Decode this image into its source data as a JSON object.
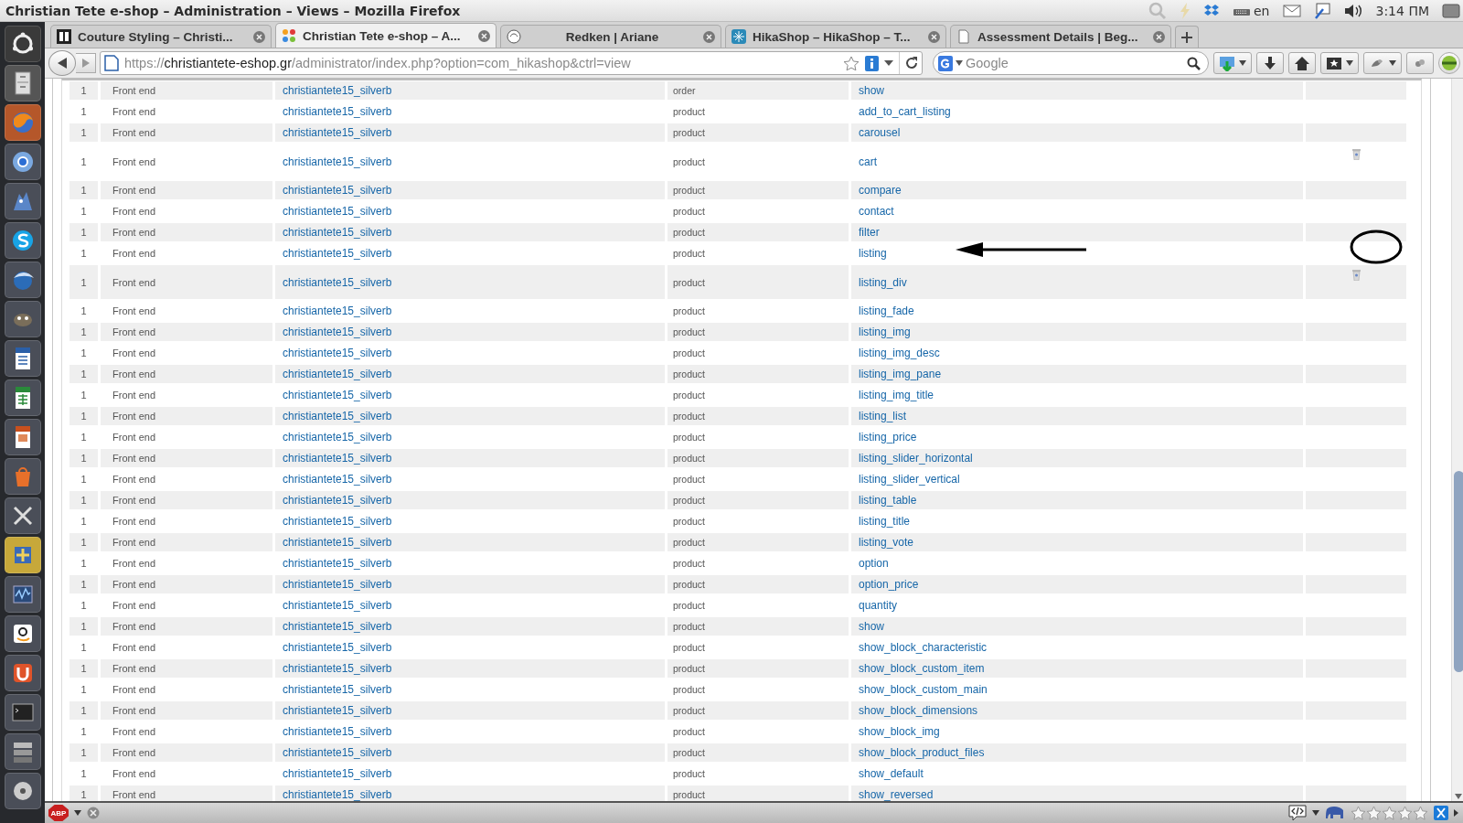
{
  "window": {
    "title": "Christian Tete e-shop – Administration – Views – Mozilla Firefox"
  },
  "system_tray": {
    "language": "en",
    "time": "3:14 ПМ"
  },
  "tabs": [
    {
      "label": "Couture Styling – Christi...",
      "selected": false
    },
    {
      "label": "Christian Tete e-shop – A...",
      "selected": true
    },
    {
      "label": "Redken | Ariane",
      "selected": false
    },
    {
      "label": "HikaShop – HikaShop – T...",
      "selected": false
    },
    {
      "label": "Assessment Details | Beg...",
      "selected": false
    }
  ],
  "address_bar": {
    "scheme": "https://",
    "domain": "christiantete-eshop.gr",
    "path": "/administrator/index.php?option=com_hikashop&ctrl=view"
  },
  "search": {
    "placeholder": "Google"
  },
  "table": {
    "rows": [
      {
        "order": "1",
        "client": "Front end",
        "template": "christiantete15_silverb",
        "type": "order",
        "view": "show",
        "trash": false
      },
      {
        "order": "1",
        "client": "Front end",
        "template": "christiantete15_silverb",
        "type": "product",
        "view": "add_to_cart_listing",
        "trash": false
      },
      {
        "order": "1",
        "client": "Front end",
        "template": "christiantete15_silverb",
        "type": "product",
        "view": "carousel",
        "trash": false
      },
      {
        "order": "1",
        "client": "Front end",
        "template": "christiantete15_silverb",
        "type": "product",
        "view": "cart",
        "trash": true
      },
      {
        "order": "1",
        "client": "Front end",
        "template": "christiantete15_silverb",
        "type": "product",
        "view": "compare",
        "trash": false
      },
      {
        "order": "1",
        "client": "Front end",
        "template": "christiantete15_silverb",
        "type": "product",
        "view": "contact",
        "trash": false
      },
      {
        "order": "1",
        "client": "Front end",
        "template": "christiantete15_silverb",
        "type": "product",
        "view": "filter",
        "trash": false
      },
      {
        "order": "1",
        "client": "Front end",
        "template": "christiantete15_silverb",
        "type": "product",
        "view": "listing",
        "trash": false
      },
      {
        "order": "1",
        "client": "Front end",
        "template": "christiantete15_silverb",
        "type": "product",
        "view": "listing_div",
        "trash": true
      },
      {
        "order": "1",
        "client": "Front end",
        "template": "christiantete15_silverb",
        "type": "product",
        "view": "listing_fade",
        "trash": false
      },
      {
        "order": "1",
        "client": "Front end",
        "template": "christiantete15_silverb",
        "type": "product",
        "view": "listing_img",
        "trash": false
      },
      {
        "order": "1",
        "client": "Front end",
        "template": "christiantete15_silverb",
        "type": "product",
        "view": "listing_img_desc",
        "trash": false
      },
      {
        "order": "1",
        "client": "Front end",
        "template": "christiantete15_silverb",
        "type": "product",
        "view": "listing_img_pane",
        "trash": false
      },
      {
        "order": "1",
        "client": "Front end",
        "template": "christiantete15_silverb",
        "type": "product",
        "view": "listing_img_title",
        "trash": false
      },
      {
        "order": "1",
        "client": "Front end",
        "template": "christiantete15_silverb",
        "type": "product",
        "view": "listing_list",
        "trash": false
      },
      {
        "order": "1",
        "client": "Front end",
        "template": "christiantete15_silverb",
        "type": "product",
        "view": "listing_price",
        "trash": false
      },
      {
        "order": "1",
        "client": "Front end",
        "template": "christiantete15_silverb",
        "type": "product",
        "view": "listing_slider_horizontal",
        "trash": false
      },
      {
        "order": "1",
        "client": "Front end",
        "template": "christiantete15_silverb",
        "type": "product",
        "view": "listing_slider_vertical",
        "trash": false
      },
      {
        "order": "1",
        "client": "Front end",
        "template": "christiantete15_silverb",
        "type": "product",
        "view": "listing_table",
        "trash": false
      },
      {
        "order": "1",
        "client": "Front end",
        "template": "christiantete15_silverb",
        "type": "product",
        "view": "listing_title",
        "trash": false
      },
      {
        "order": "1",
        "client": "Front end",
        "template": "christiantete15_silverb",
        "type": "product",
        "view": "listing_vote",
        "trash": false
      },
      {
        "order": "1",
        "client": "Front end",
        "template": "christiantete15_silverb",
        "type": "product",
        "view": "option",
        "trash": false
      },
      {
        "order": "1",
        "client": "Front end",
        "template": "christiantete15_silverb",
        "type": "product",
        "view": "option_price",
        "trash": false
      },
      {
        "order": "1",
        "client": "Front end",
        "template": "christiantete15_silverb",
        "type": "product",
        "view": "quantity",
        "trash": false
      },
      {
        "order": "1",
        "client": "Front end",
        "template": "christiantete15_silverb",
        "type": "product",
        "view": "show",
        "trash": false
      },
      {
        "order": "1",
        "client": "Front end",
        "template": "christiantete15_silverb",
        "type": "product",
        "view": "show_block_characteristic",
        "trash": false
      },
      {
        "order": "1",
        "client": "Front end",
        "template": "christiantete15_silverb",
        "type": "product",
        "view": "show_block_custom_item",
        "trash": false
      },
      {
        "order": "1",
        "client": "Front end",
        "template": "christiantete15_silverb",
        "type": "product",
        "view": "show_block_custom_main",
        "trash": false
      },
      {
        "order": "1",
        "client": "Front end",
        "template": "christiantete15_silverb",
        "type": "product",
        "view": "show_block_dimensions",
        "trash": false
      },
      {
        "order": "1",
        "client": "Front end",
        "template": "christiantete15_silverb",
        "type": "product",
        "view": "show_block_img",
        "trash": false
      },
      {
        "order": "1",
        "client": "Front end",
        "template": "christiantete15_silverb",
        "type": "product",
        "view": "show_block_product_files",
        "trash": false
      },
      {
        "order": "1",
        "client": "Front end",
        "template": "christiantete15_silverb",
        "type": "product",
        "view": "show_default",
        "trash": false
      },
      {
        "order": "1",
        "client": "Front end",
        "template": "christiantete15_silverb",
        "type": "product",
        "view": "show_reversed",
        "trash": false
      }
    ]
  },
  "annotations": [
    {
      "kind": "arrow"
    },
    {
      "kind": "ellipse"
    }
  ],
  "status_bar": {
    "adblock_label": "ABP",
    "rating": {
      "stars": 0
    }
  }
}
